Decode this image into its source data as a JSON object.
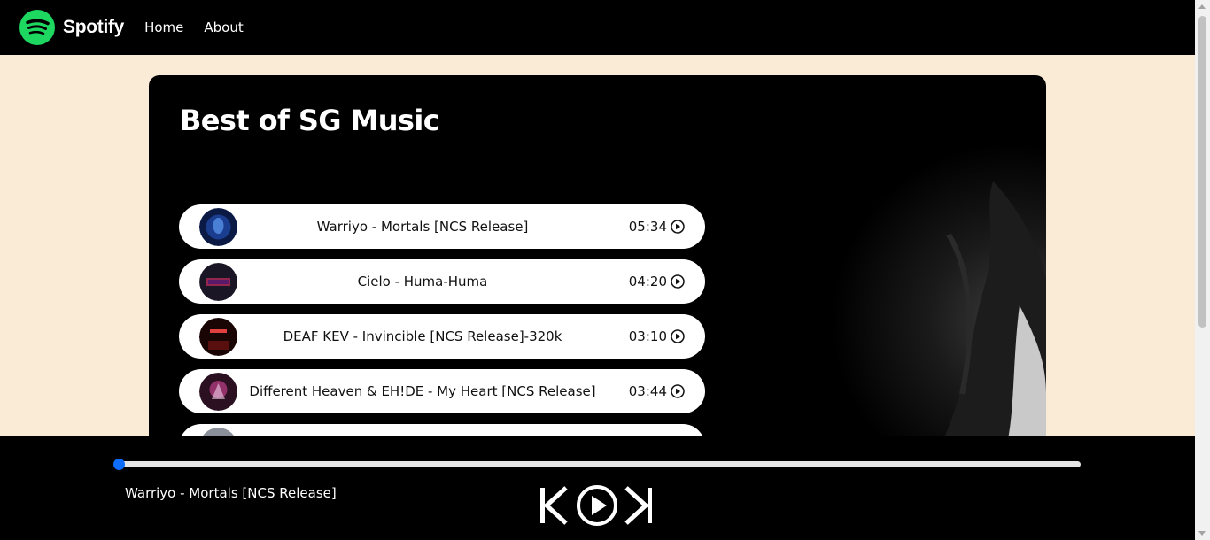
{
  "nav": {
    "brand": "Spotify",
    "links": [
      "Home",
      "About"
    ]
  },
  "main": {
    "title": "Best of SG Music",
    "songs": [
      {
        "name": "Warriyo - Mortals [NCS Release]",
        "duration": "05:34",
        "cover_color": "#1a3d8f"
      },
      {
        "name": "Cielo - Huma-Huma",
        "duration": "04:20",
        "cover_color": "#2a1a3a"
      },
      {
        "name": "DEAF KEV - Invincible [NCS Release]-320k",
        "duration": "03:10",
        "cover_color": "#3a0d0d"
      },
      {
        "name": "Different Heaven & EH!DE - My Heart [NCS Release]",
        "duration": "03:44",
        "cover_color": "#3a1030"
      },
      {
        "name": "",
        "duration": "",
        "cover_color": "#8a9099"
      }
    ]
  },
  "player": {
    "current_song": "Warriyo - Mortals [NCS Release]",
    "progress": 0
  },
  "colors": {
    "page_bg": "#faebd7",
    "brand_green": "#1ed760",
    "progress_thumb": "#0d6efd"
  }
}
